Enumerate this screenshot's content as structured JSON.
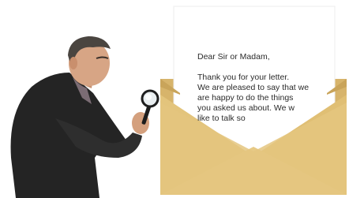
{
  "letter": {
    "greeting": "Dear Sir or Madam,",
    "lines": [
      "Thank you for your letter.",
      "We are pleased to say that we",
      "are happy to do the things",
      "you asked us about. We w",
      "like to talk so"
    ]
  }
}
